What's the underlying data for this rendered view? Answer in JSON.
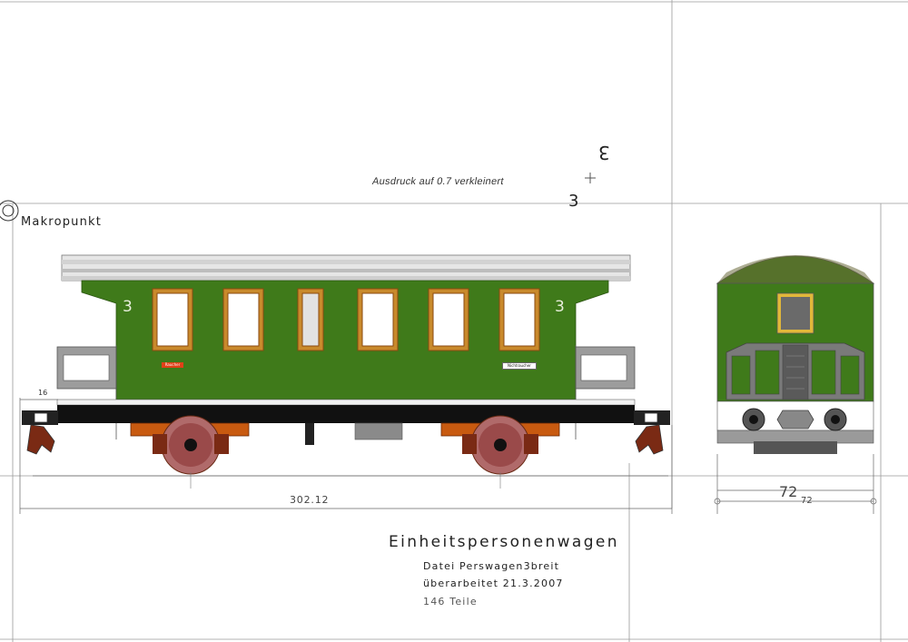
{
  "drawing": {
    "print_note": "Ausdruck auf 0.7 verkleinert",
    "macro_label": "Makropunkt",
    "marker_number_rotated": "3",
    "marker_number": "3",
    "title": "Einheitspersonenwagen",
    "file_line": "Datei Perswagen3breit",
    "revision_line": "überarbeitet 21.3.2007",
    "parts_line": "146 Teile"
  },
  "side_view": {
    "class_number_left": "3",
    "class_number_right": "3",
    "sign_left": "Raucher",
    "sign_right": "Nichtraucher"
  },
  "dimensions": {
    "overall_length": "302.12",
    "buffer_length": "16",
    "end_width_large": "72",
    "end_width_small": "72"
  },
  "colors": {
    "body_green": "#3f7a1a",
    "window_frame": "#c07a20",
    "roof_grey": "#c8c8c8",
    "frame_black": "#111111",
    "wheel_red": "#7a2a14",
    "bogie_orange": "#c85a10"
  }
}
